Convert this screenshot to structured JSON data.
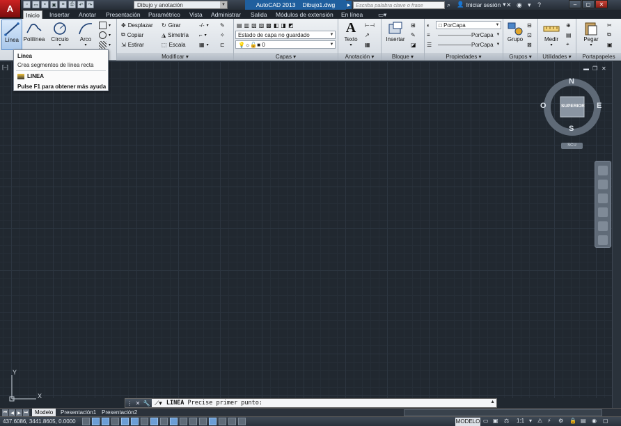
{
  "titlebar": {
    "logo": "A",
    "workspace": "Dibujo y anotación",
    "app_name": "AutoCAD 2013",
    "file_name": "Dibujo1.dwg",
    "search_placeholder": "Escriba palabra clave o frase",
    "signin": "Iniciar sesión",
    "quick_access_icons": [
      "new-icon",
      "open-icon",
      "save-icon",
      "saveas-icon",
      "print-icon",
      "undo-icon",
      "redo-icon"
    ]
  },
  "tabs": [
    {
      "label": "Inicio",
      "active": true
    },
    {
      "label": "Insertar"
    },
    {
      "label": "Anotar"
    },
    {
      "label": "Presentación"
    },
    {
      "label": "Paramétrico"
    },
    {
      "label": "Vista"
    },
    {
      "label": "Administrar"
    },
    {
      "label": "Salida"
    },
    {
      "label": "Módulos de extensión"
    },
    {
      "label": "En línea"
    }
  ],
  "ribbon": {
    "draw": {
      "linea": "Línea",
      "polilinea": "Polilínea",
      "circulo": "Círculo",
      "arco": "Arco"
    },
    "modify": {
      "title": "Modificar",
      "desplazar": "Desplazar",
      "girar": "Girar",
      "copiar": "Copiar",
      "simetria": "Simetría",
      "estirar": "Estirar",
      "escala": "Escala"
    },
    "layers": {
      "title": "Capas",
      "state": "Estado de capa no guardado",
      "current_layer": "0"
    },
    "annotation": {
      "title": "Anotación",
      "texto": "Texto"
    },
    "block": {
      "title": "Bloque",
      "insertar": "Insertar"
    },
    "properties": {
      "title": "Propiedades",
      "color": "PorCapa",
      "linetype": "PorCapa",
      "lineweight": "PorCapa"
    },
    "groups": {
      "title": "Grupos",
      "grupo": "Grupo"
    },
    "utilities": {
      "title": "Utilidades",
      "medir": "Medir"
    },
    "clipboard": {
      "title": "Portapapeles",
      "pegar": "Pegar"
    }
  },
  "tooltip": {
    "title": "Línea",
    "description": "Crea segmentos de línea recta",
    "command": "LINEA",
    "help": "Pulse F1 para obtener más ayuda"
  },
  "viewport": {
    "label": "[–]"
  },
  "viewcube": {
    "face": "SUPERIOR",
    "north": "N",
    "south": "S",
    "east": "E",
    "west": "O",
    "wcs": "SCU"
  },
  "ucs": {
    "x": "X",
    "y": "Y"
  },
  "command_line": {
    "command": "LINEA",
    "prompt": "Precise primer punto:"
  },
  "layout_tabs": [
    {
      "label": "Modelo",
      "active": true
    },
    {
      "label": "Presentación1"
    },
    {
      "label": "Presentación2"
    }
  ],
  "status": {
    "coordinates": "437.6086, 3441.8605, 0.0000",
    "space": "MODELO",
    "scale": "1:1"
  }
}
